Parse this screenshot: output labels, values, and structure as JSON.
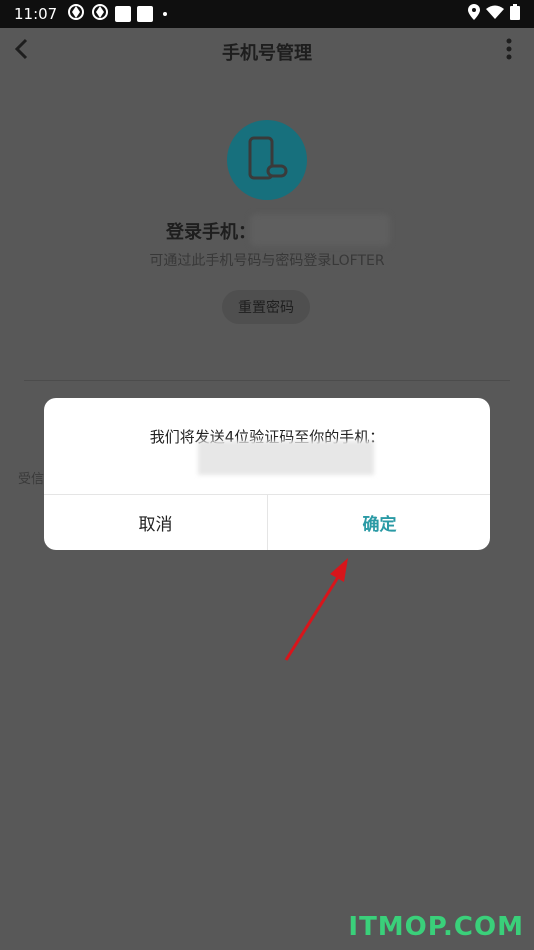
{
  "status_bar": {
    "time": "11:07"
  },
  "header": {
    "title": "手机号管理"
  },
  "account": {
    "login_label": "登录手机：",
    "hint": "可通过此手机号码与密码登录LOFTER",
    "reset_password": "重置密码"
  },
  "background": {
    "partial_text": "受信"
  },
  "dialog": {
    "message": "我们将发送4位验证码至你的手机：",
    "cancel": "取消",
    "confirm": "确定"
  },
  "watermark": "ITMOP.COM",
  "colors": {
    "accent": "#2a9aa5",
    "avatar_bg": "#17707d",
    "watermark": "#3ad07a"
  }
}
